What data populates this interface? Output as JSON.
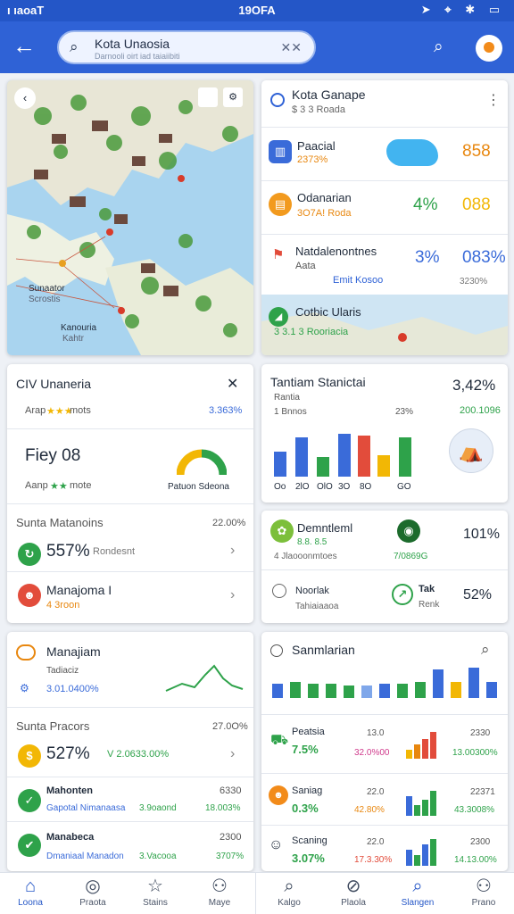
{
  "status_bar": {
    "left": "ı ıaoaT",
    "center": "19OFA",
    "right": "➤ ⌖ ✱ ▭"
  },
  "search": {
    "title": "Kota Unaosia",
    "subtitle": "Darnooli oirt iad taiaiibiti",
    "clear_icon": "✕✕"
  },
  "map": {
    "label_1": "Sunaator",
    "label_2": "Scrostis",
    "label_3": "Kanouria",
    "label_4": "Kahtr"
  },
  "card_city": {
    "title": "Kota Ganape",
    "subtitle": "$ 3 3 Roada",
    "rows": [
      {
        "label": "Paacial",
        "sub": "2373%",
        "value": "858"
      },
      {
        "label": "Odanarian",
        "sub": "3O7A! Roda",
        "value_green": "4%",
        "value": "088"
      },
      {
        "label": "Natdalenontnes",
        "sub": "Aata",
        "sub2": "Emit Kosoo",
        "value_blue": "3%",
        "value": "083%",
        "value_small": "3230%"
      }
    ],
    "map_title": "Cotbic Ularis",
    "map_sub": "3 3.1 3 Rooriacia"
  },
  "card_indonesia": {
    "title": "CIV Unaneria",
    "sub_left": "Arap",
    "sub_mid": "mots",
    "sub_right": "3.363%",
    "big": "Fiey 08",
    "big_sub_left": "Aanp",
    "big_sub_mid": "mote",
    "donut_label": "Patuon Sdeona",
    "section_title": "Sunta Matanoins",
    "section_value": "22.00%",
    "rows": [
      {
        "value": "557%",
        "sub": "Rondesnt"
      },
      {
        "value": "Manajoma I",
        "sub": "4 3roon"
      }
    ]
  },
  "card_stat": {
    "title": "Tantiam Stanictai",
    "value": "3,42%",
    "sub": "Rantia",
    "sub2": "1 Bnnos",
    "sub_mid": "23%",
    "sub_right": "200.1096",
    "chart_labels": [
      "Oo",
      "2lO",
      "OlO",
      "3O",
      "8O",
      "GO"
    ]
  },
  "card_demo": {
    "row1_title": "Demntleml",
    "row1_sub": "8.8. 8.5",
    "row1_sub2": "4 Jlaooonmtoes",
    "row1_mid": "7/0869G",
    "row1_value": "101%",
    "row2_title": "Noorlak",
    "row2_sub": "Tahiaiaaoa",
    "row2_mid_title": "Tak",
    "row2_mid_sub": "Renk",
    "row2_value": "52%"
  },
  "card_manajiam": {
    "title": "Manajiam",
    "sub": "Tadiaciz",
    "sub2": "3.01.0400%",
    "section_title": "Sunta Pracors",
    "section_value": "27.0O%",
    "rows": [
      {
        "value": "527%",
        "sub": "V 2.0633.00%"
      },
      {
        "title": "Mahonten",
        "sub": "Gapotal Nimanaasa",
        "sub_mid": "3.9oaond",
        "right_top": "6330",
        "right_bottom": "18.003%"
      },
      {
        "title": "Manabeca",
        "sub": "Dmaniaal Manadon",
        "sub_mid": "3.Vacooa",
        "right_top": "2300",
        "right_bottom": "3707%"
      }
    ]
  },
  "card_sanmartan": {
    "title": "Sanmlarian",
    "rows": [
      {
        "title": "Peatsia",
        "value": "7.5%",
        "mid_top": "13.0",
        "mid_bottom": "32.0%00",
        "right_top": "2330",
        "right_bottom": "13.00300%"
      },
      {
        "title": "Saniag",
        "value": "0.3%",
        "mid_top": "22.0",
        "mid_bottom": "42.80%",
        "right_top": "22371",
        "right_bottom": "43.3008%"
      },
      {
        "title": "Scaning",
        "value": "3.07%",
        "mid_top": "22.0",
        "mid_bottom": "17.3.30%",
        "right_top": "2300",
        "right_bottom": "14.13.00%"
      }
    ]
  },
  "nav": {
    "items": [
      {
        "label": "Loona",
        "icon": "home-icon",
        "glyph": "⌂"
      },
      {
        "label": "Praota",
        "icon": "globe-icon",
        "glyph": "◎"
      },
      {
        "label": "Stains",
        "icon": "star-icon",
        "glyph": "☆"
      },
      {
        "label": "Maye",
        "icon": "user-icon",
        "glyph": "⚇"
      },
      {
        "label": "Kalgo",
        "icon": "search-icon",
        "glyph": "⌕"
      },
      {
        "label": "Plaola",
        "icon": "compass-icon",
        "glyph": "⊘"
      },
      {
        "label": "Slangen",
        "icon": "search-active-icon",
        "glyph": "⌕"
      },
      {
        "label": "Prano",
        "icon": "profile-icon",
        "glyph": "⚇"
      }
    ]
  }
}
